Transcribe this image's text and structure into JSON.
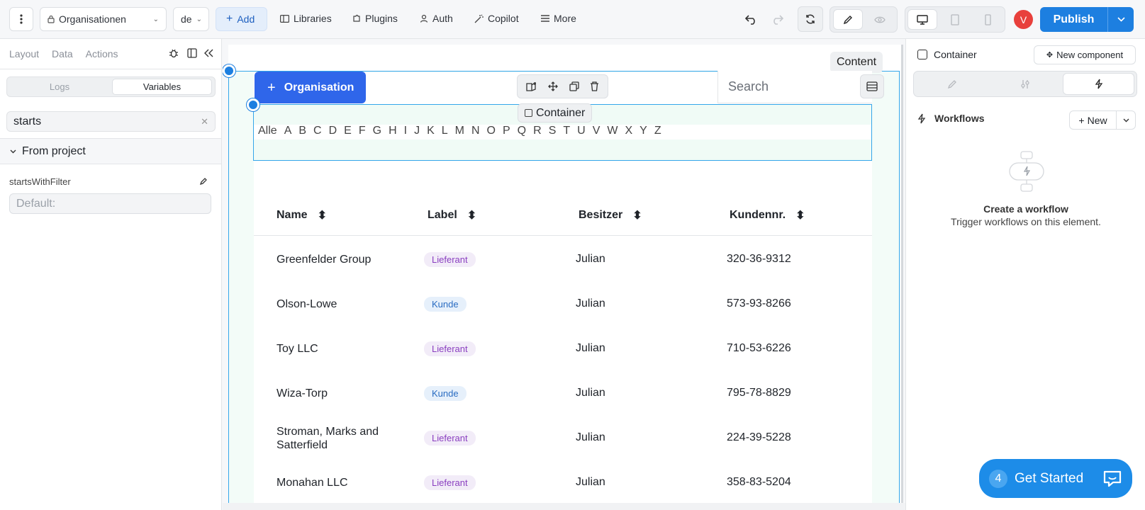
{
  "topbar": {
    "page_select": "Organisationen",
    "lang_select": "de",
    "add": "Add",
    "libraries": "Libraries",
    "plugins": "Plugins",
    "auth": "Auth",
    "copilot": "Copilot",
    "more": "More",
    "avatar": "V",
    "publish": "Publish"
  },
  "left": {
    "tabs": [
      "Layout",
      "Data",
      "Actions"
    ],
    "seg": [
      "Logs",
      "Variables"
    ],
    "search_value": "starts",
    "group": "From project",
    "var_name": "startsWithFilter",
    "var_placeholder": "Default:"
  },
  "canvas": {
    "content_label": "Content",
    "org_button": "Organisation",
    "search_placeholder": "Search",
    "container_label": "Container",
    "letters": [
      "Alle",
      "A",
      "B",
      "C",
      "D",
      "E",
      "F",
      "G",
      "H",
      "I",
      "J",
      "K",
      "L",
      "M",
      "N",
      "O",
      "P",
      "Q",
      "R",
      "S",
      "T",
      "U",
      "V",
      "W",
      "X",
      "Y",
      "Z"
    ],
    "columns": [
      "Name",
      "Label",
      "Besitzer",
      "Kundennr."
    ],
    "rows": [
      {
        "name": "Greenfelder Group",
        "label": "Lieferant",
        "owner": "Julian",
        "no": "320-36-9312"
      },
      {
        "name": "Olson-Lowe",
        "label": "Kunde",
        "owner": "Julian",
        "no": "573-93-8266"
      },
      {
        "name": "Toy LLC",
        "label": "Lieferant",
        "owner": "Julian",
        "no": "710-53-6226"
      },
      {
        "name": "Wiza-Torp",
        "label": "Kunde",
        "owner": "Julian",
        "no": "795-78-8829"
      },
      {
        "name": "Stroman, Marks and Satterfield",
        "label": "Lieferant",
        "owner": "Julian",
        "no": "224-39-5228"
      },
      {
        "name": "Monahan LLC",
        "label": "Lieferant",
        "owner": "Julian",
        "no": "358-83-5204"
      }
    ]
  },
  "right": {
    "container_label": "Container",
    "new_component": "New component",
    "workflows": "Workflows",
    "new": "New",
    "empty_title": "Create a workflow",
    "empty_sub": "Trigger workflows on this element."
  },
  "get_started": {
    "count": "4",
    "label": "Get Started"
  },
  "colors": {
    "accent": "#1d7fe0",
    "lieferant_bg": "#f2ecf8",
    "lieferant_fg": "#8a3fc0",
    "kunde_bg": "#e6f0fb",
    "kunde_fg": "#2a6cc2"
  }
}
